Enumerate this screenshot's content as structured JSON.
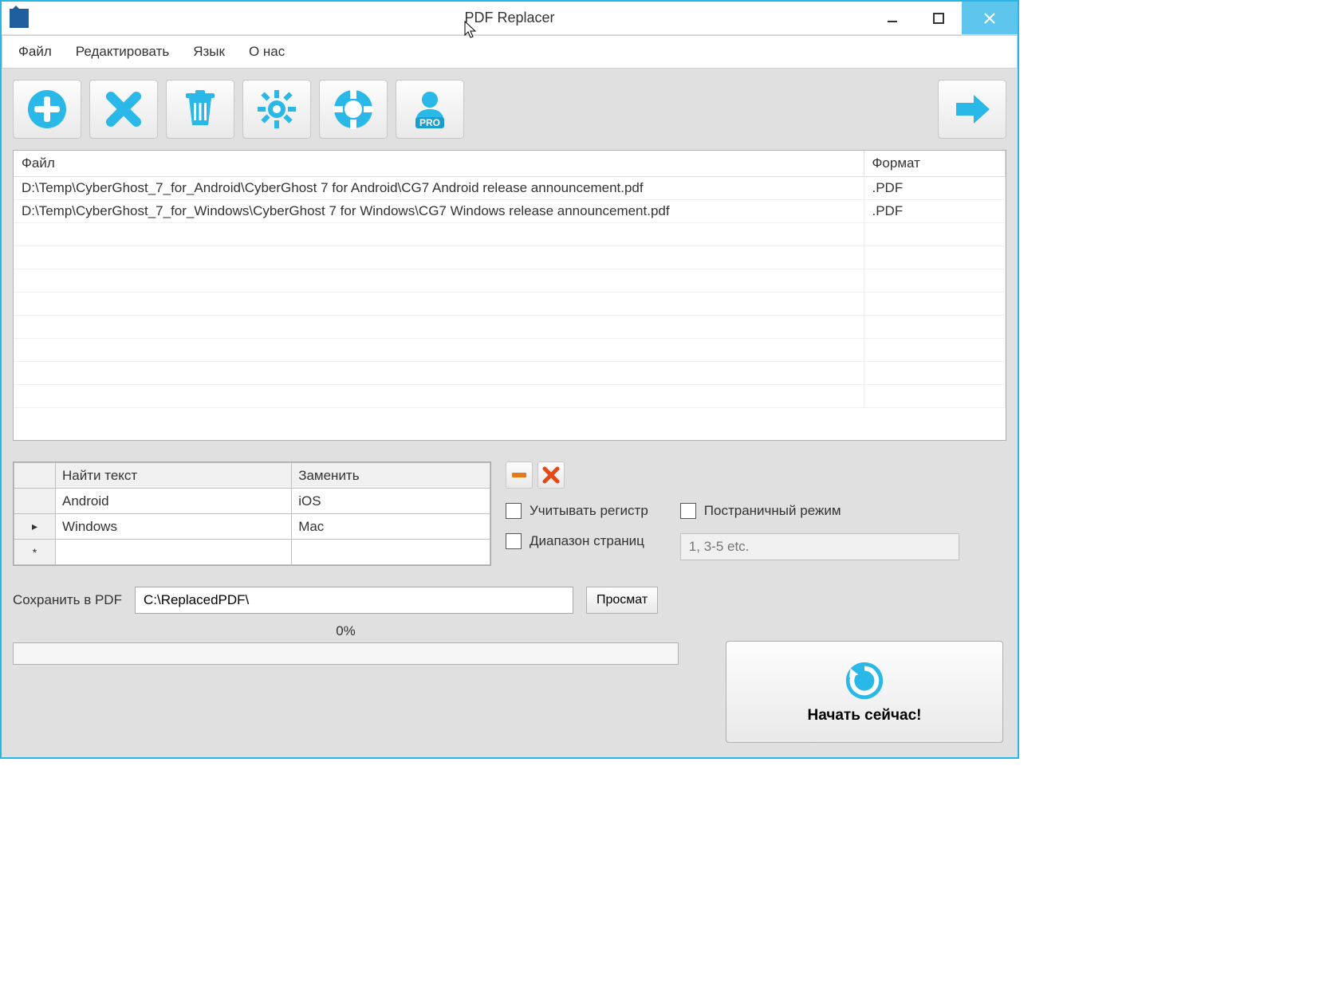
{
  "title": "PDF Replacer",
  "menu": {
    "file": "Файл",
    "edit": "Редактировать",
    "lang": "Язык",
    "about": "О нас"
  },
  "toolbar": {
    "add": "add",
    "remove": "remove",
    "clear": "clear",
    "settings": "settings",
    "help": "help",
    "pro": "PRO",
    "go": "go"
  },
  "filelist": {
    "headers": {
      "file": "Файл",
      "format": "Формат"
    },
    "rows": [
      {
        "file": "D:\\Temp\\CyberGhost_7_for_Android\\CyberGhost 7 for Android\\CG7 Android release announcement.pdf",
        "format": ".PDF"
      },
      {
        "file": "D:\\Temp\\CyberGhost_7_for_Windows\\CyberGhost 7 for Windows\\CG7 Windows release announcement.pdf",
        "format": ".PDF"
      }
    ]
  },
  "replace": {
    "headers": {
      "find": "Найти текст",
      "replace": "Заменить"
    },
    "rows": [
      {
        "marker": "",
        "find": "Android",
        "replace": "iOS"
      },
      {
        "marker": "▸",
        "find": "Windows",
        "replace": "Mac"
      },
      {
        "marker": "*",
        "find": "",
        "replace": ""
      }
    ]
  },
  "options": {
    "case_sensitive": "Учитывать регистр",
    "page_mode": "Постраничный режим",
    "page_range": "Диапазон страниц",
    "page_range_placeholder": "1, 3-5 etc."
  },
  "save": {
    "label": "Сохранить в PDF",
    "value": "C:\\ReplacedPDF\\",
    "browse": "Просмат"
  },
  "progress": {
    "pct": "0%"
  },
  "start": {
    "label": "Начать сейчас!"
  }
}
